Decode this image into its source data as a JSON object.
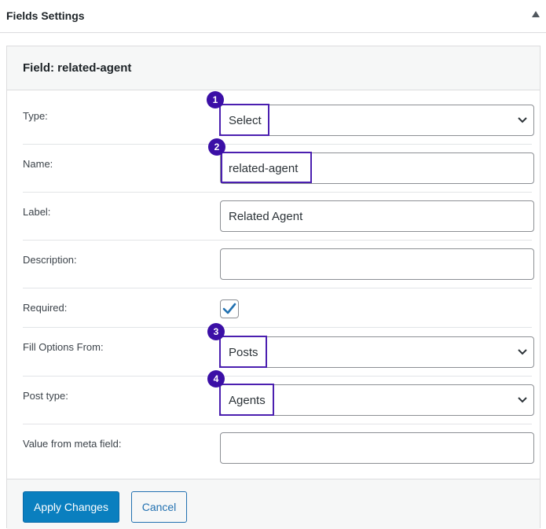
{
  "metabox": {
    "title": "Fields Settings"
  },
  "panel": {
    "title": "Field: related-agent"
  },
  "fields": {
    "type": {
      "label": "Type:",
      "value": "Select",
      "badge": "1"
    },
    "name": {
      "label": "Name:",
      "value": "related-agent",
      "badge": "2"
    },
    "label": {
      "label": "Label:",
      "value": "Related Agent"
    },
    "description": {
      "label": "Description:",
      "value": ""
    },
    "required": {
      "label": "Required:",
      "checked": true
    },
    "fill_options": {
      "label": "Fill Options From:",
      "value": "Posts",
      "badge": "3"
    },
    "post_type": {
      "label": "Post type:",
      "value": "Agents",
      "badge": "4"
    },
    "meta_field": {
      "label": "Value from meta field:",
      "value": ""
    }
  },
  "footer": {
    "apply_label": "Apply Changes",
    "cancel_label": "Cancel"
  },
  "colors": {
    "primary": "#0a7fbf",
    "highlight": "#4b1fb0",
    "badge": "#3b0fa6",
    "checkmark": "#2271b1"
  },
  "icons": {
    "toggle": "triangle-up-icon",
    "select": "chevron-down-icon",
    "checkbox": "checkmark-icon"
  }
}
